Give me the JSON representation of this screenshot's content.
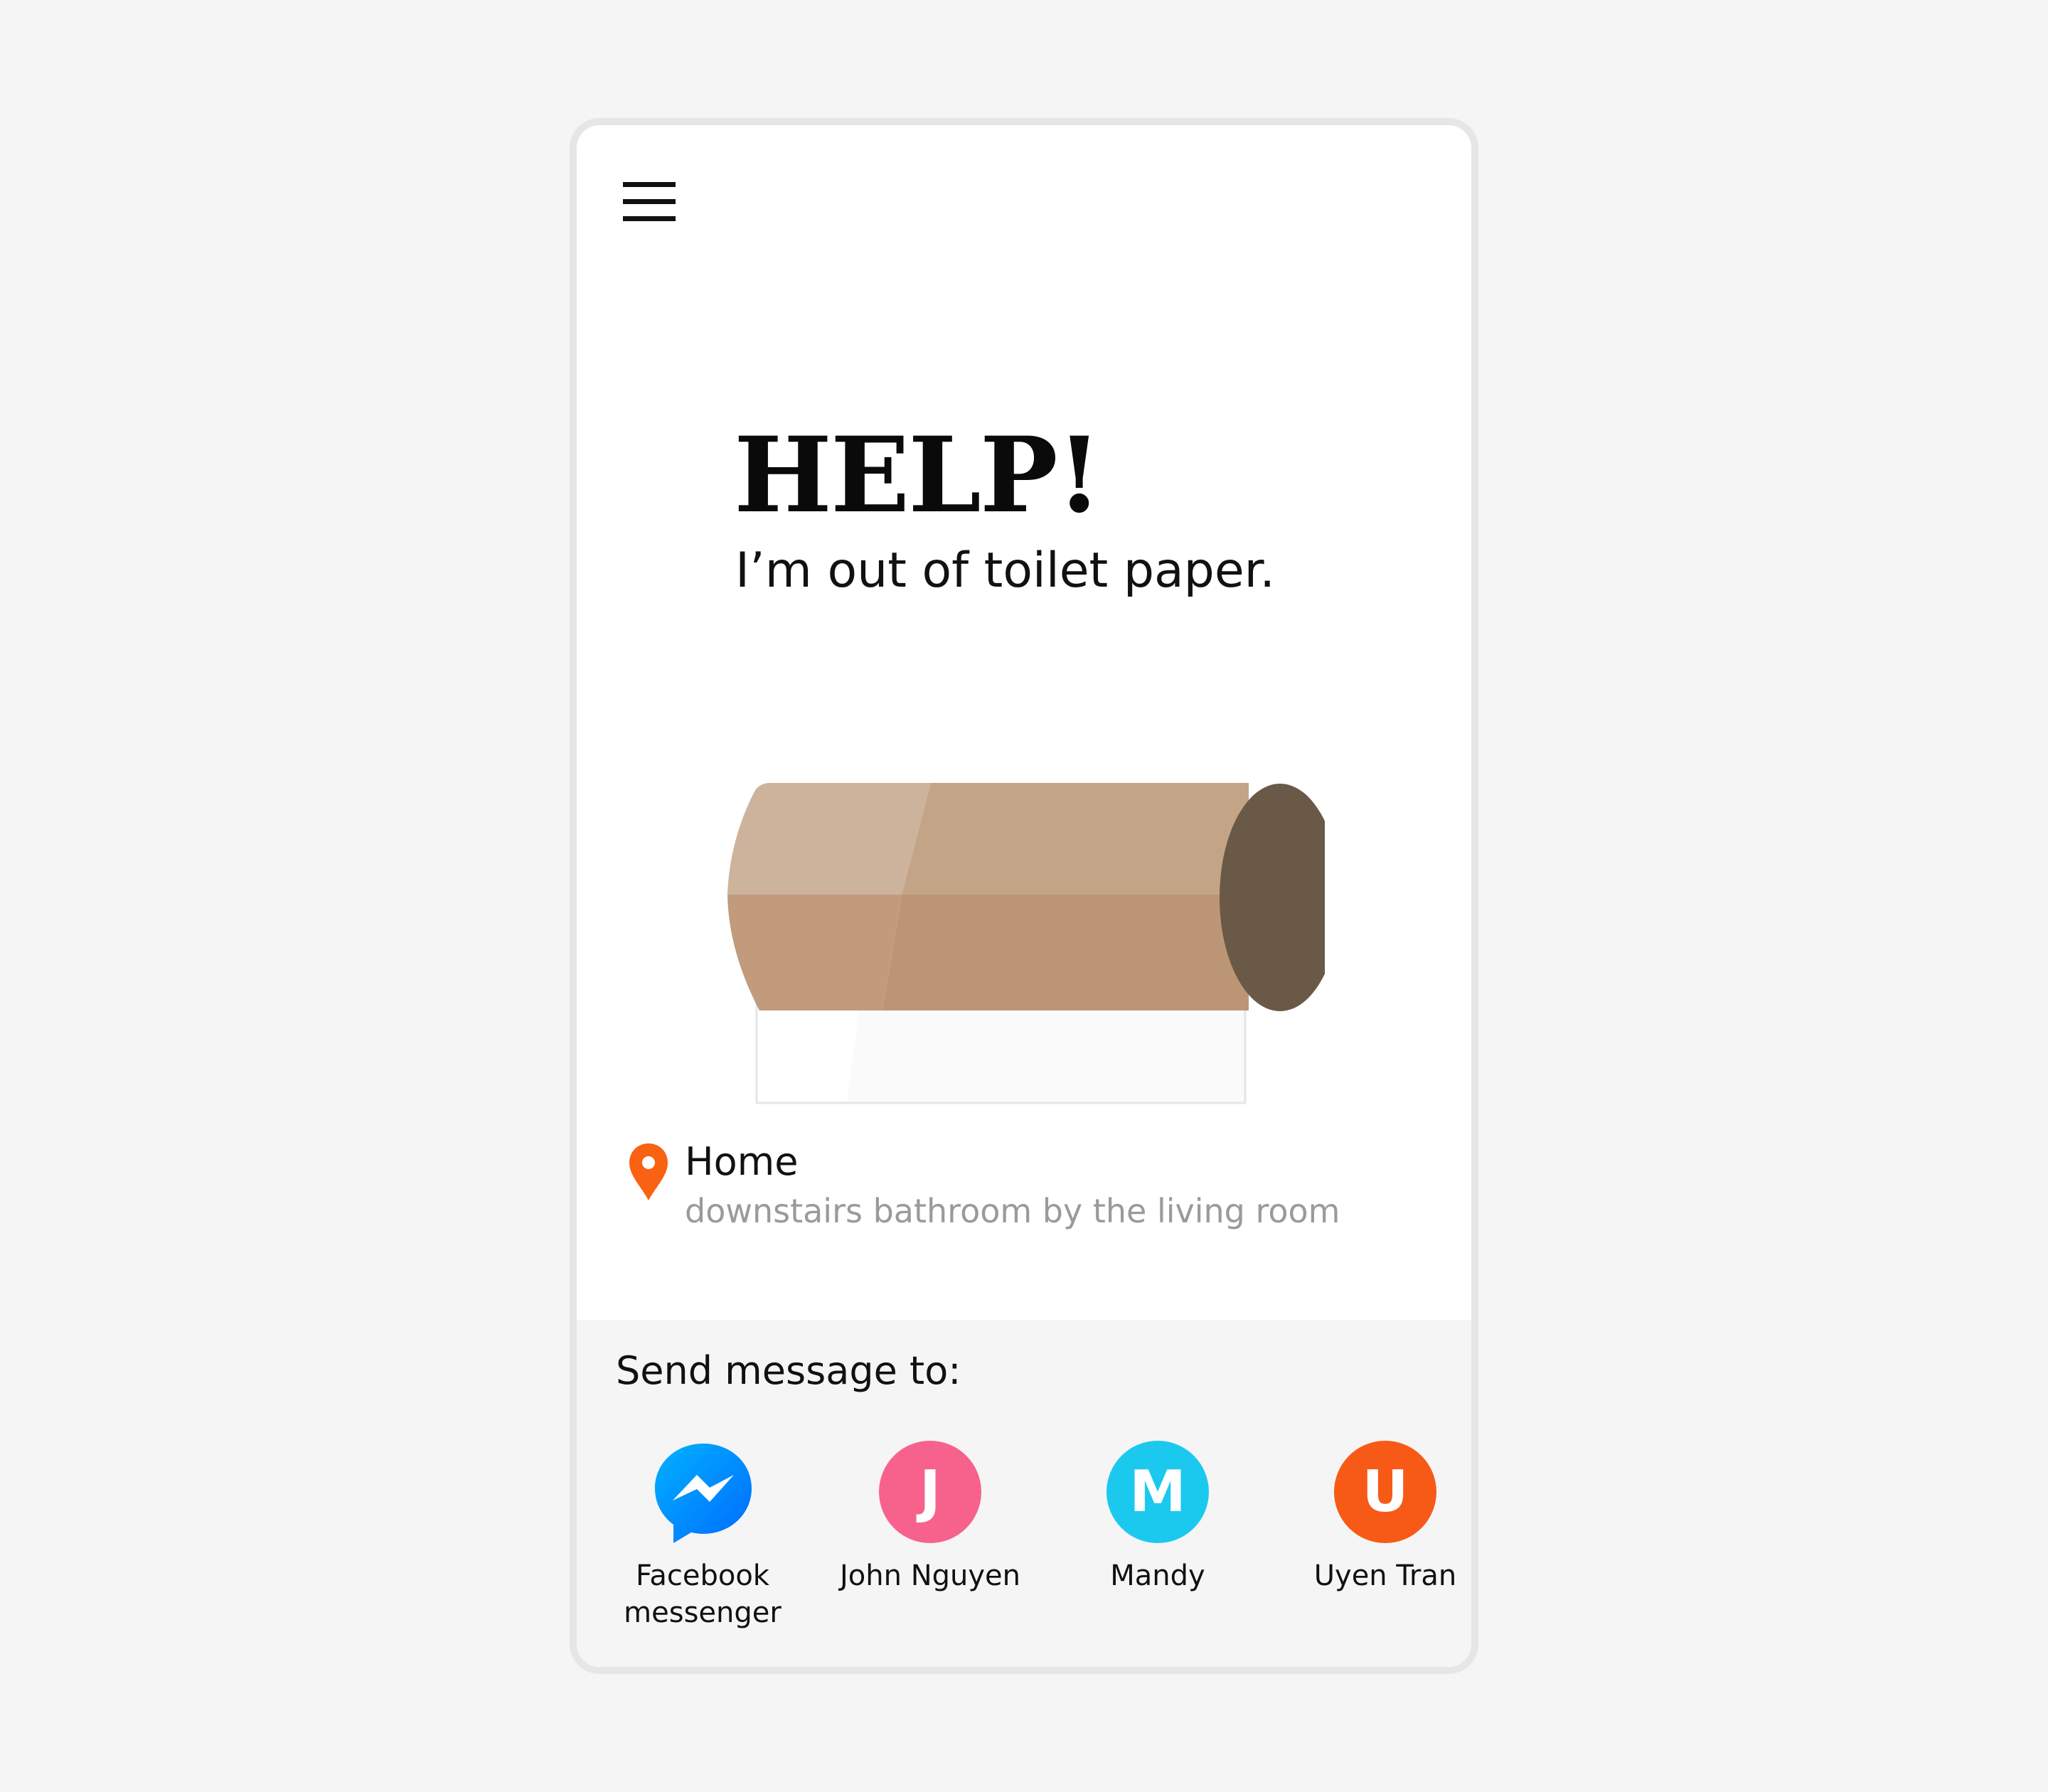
{
  "menu": {
    "icon": "hamburger-menu-icon"
  },
  "hero": {
    "headline": "HELP!",
    "subheadline": "I’m out of toilet paper."
  },
  "illustration": {
    "icon": "empty-toilet-paper-roll",
    "colors": {
      "roll_top_light": "#ceb39c",
      "roll_top": "#c4a487",
      "roll_bottom_light": "#c19b7c",
      "roll_bottom": "#bc9674",
      "roll_end": "#6a5946",
      "holder_outline": "#e6e6e6"
    }
  },
  "location": {
    "icon": "map-pin-icon",
    "pin_color": "#f86212",
    "name": "Home",
    "detail": "downstairs bathroom by the living room"
  },
  "send": {
    "label": "Send message to:",
    "contacts": [
      {
        "name": "Facebook messenger",
        "line1": "Facebook",
        "line2": "messenger",
        "icon": "facebook-messenger-icon",
        "color": "#0a7cff"
      },
      {
        "name": "John Nguyen",
        "initial": "J",
        "color": "#f7628d"
      },
      {
        "name": "Mandy",
        "initial": "M",
        "color": "#1bc9ef"
      },
      {
        "name": "Uyen Tran",
        "initial": "U",
        "color": "#f75a17"
      }
    ]
  }
}
